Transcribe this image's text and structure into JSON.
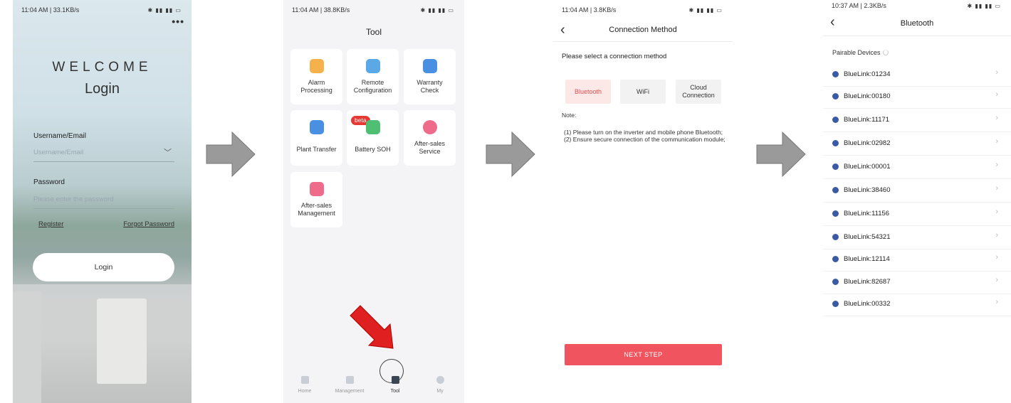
{
  "screen1": {
    "status_time": "11:04 AM | 33.1KB/s",
    "more": "•••",
    "welcome": "WELCOME",
    "title": "Login",
    "username_label": "Username/Email",
    "username_placeholder": "Username/Email",
    "password_label": "Password",
    "password_placeholder": "Please enter the password",
    "register": "Register",
    "forgot": "Forgot Password",
    "login_button": "Login"
  },
  "screen2": {
    "status_time": "11:04 AM | 38.8KB/s",
    "title": "Tool",
    "tiles": [
      {
        "label": "Alarm Processing",
        "icon": "alarm-icon",
        "color": "#f5b14c"
      },
      {
        "label": "Remote Configuration",
        "icon": "remote-config-icon",
        "color": "#5aa9e6"
      },
      {
        "label": "Warranty Check",
        "icon": "warranty-icon",
        "color": "#4a90e2"
      },
      {
        "label": "Plant Transfer",
        "icon": "plant-transfer-icon",
        "color": "#4a90e2"
      },
      {
        "label": "Battery SOH",
        "icon": "battery-icon",
        "color": "#4fbf73",
        "badge": "beta"
      },
      {
        "label": "After-sales Service",
        "icon": "heart-hand-icon",
        "color": "#ef6b8a"
      },
      {
        "label": "After-sales Management",
        "icon": "management-icon",
        "color": "#ef6b8a"
      }
    ],
    "nav": [
      {
        "label": "Home",
        "icon": "home-icon"
      },
      {
        "label": "Management",
        "icon": "management-tab-icon"
      },
      {
        "label": "Tool",
        "icon": "tool-tab-icon",
        "active": true
      },
      {
        "label": "My",
        "icon": "profile-icon"
      }
    ]
  },
  "screen3": {
    "status_time": "11:04 AM | 3.8KB/s",
    "title": "Connection Method",
    "prompt": "Please select a connection method",
    "options": [
      "Bluetooth",
      "WiFi",
      "Cloud Connection"
    ],
    "note_label": "Note:",
    "note_lines": [
      "(1) Please turn on the inverter and mobile phone Bluetooth;",
      "(2) Ensure secure connection of the communication module;"
    ],
    "next_button": "NEXT STEP"
  },
  "screen4": {
    "status_time": "10:37 AM | 2.3KB/s",
    "title": "Bluetooth",
    "pairable_label": "Pairable Devices",
    "devices": [
      "BlueLink:01234",
      "BlueLink:00180",
      "BlueLink:11171",
      "BlueLink:02982",
      "BlueLink:00001",
      "BlueLink:38460",
      "BlueLink:11156",
      "BlueLink:54321",
      "BlueLink:12114",
      "BlueLink:82687",
      "BlueLink:00332"
    ]
  },
  "colors": {
    "accent_red": "#f0555f",
    "bluetooth_blue": "#3b5aa6",
    "flow_arrow": "#9a9a9a",
    "pointer_arrow": "#e02020"
  }
}
